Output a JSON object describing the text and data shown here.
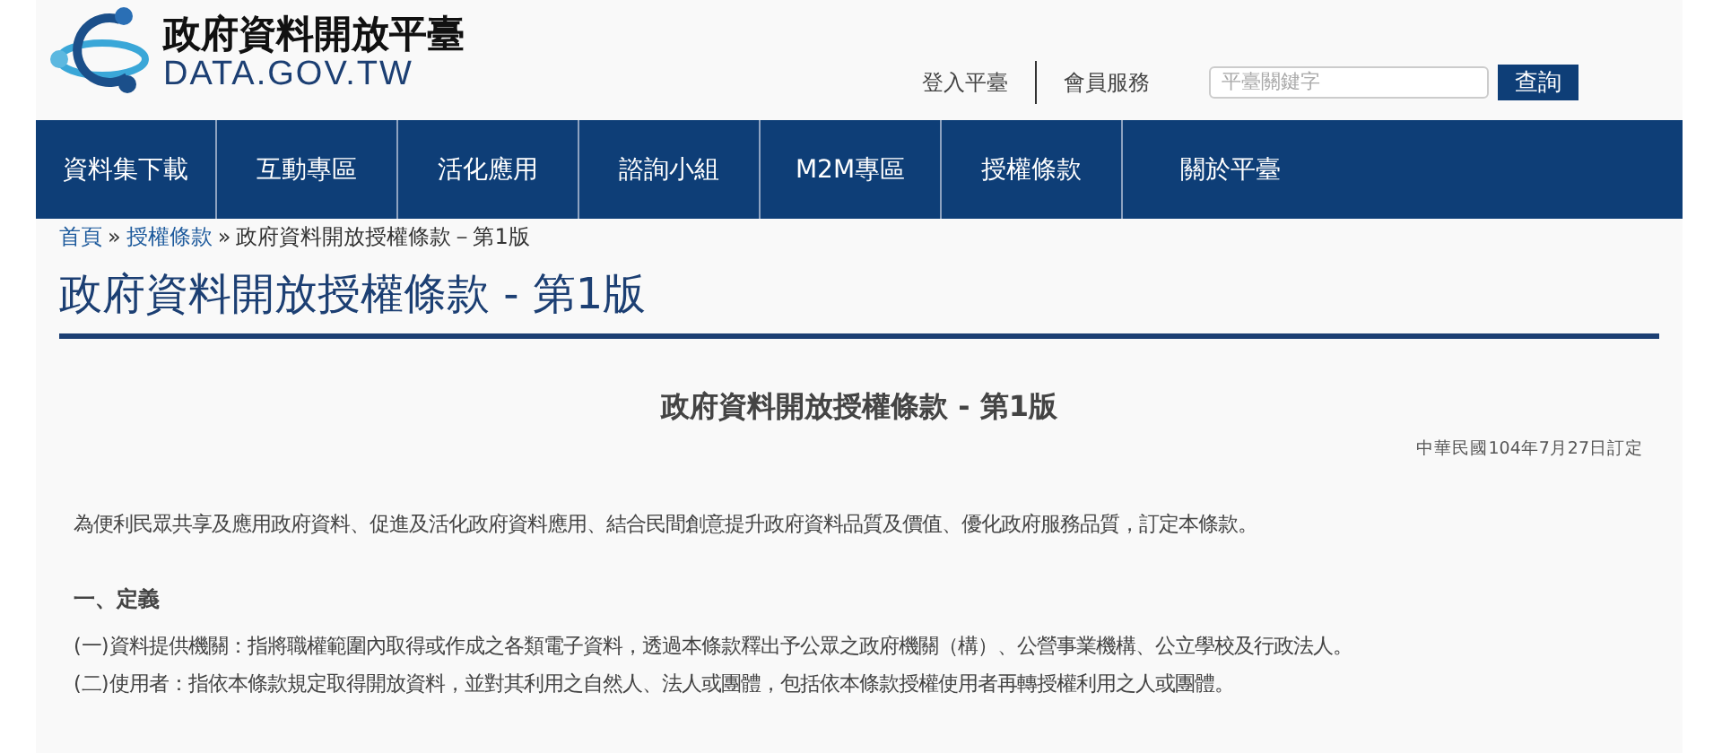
{
  "logo": {
    "title": "政府資料開放平臺",
    "subtitle": "DATA.GOV.TW"
  },
  "top_links": [
    "登入平臺",
    "會員服務"
  ],
  "search": {
    "placeholder": "平臺關鍵字",
    "button": "查詢"
  },
  "nav": [
    "資料集下載",
    "互動專區",
    "活化應用",
    "諮詢小組",
    "M2M專區",
    "授權條款",
    "關於平臺"
  ],
  "breadcrumb": {
    "links": [
      "首頁",
      "授權條款"
    ],
    "separator": "»",
    "current": "政府資料開放授權條款－第1版"
  },
  "page_title": "政府資料開放授權條款 - 第1版",
  "document": {
    "title": "政府資料開放授權條款 - 第1版",
    "date": "中華民國104年7月27日訂定",
    "intro": "為便利民眾共享及應用政府資料、促進及活化政府資料應用、結合民間創意提升政府資料品質及價值、優化政府服務品質，訂定本條款。",
    "section": "一、定義",
    "items": [
      "(一)資料提供機關：指將職權範圍內取得或作成之各類電子資料，透過本條款釋出予公眾之政府機關（構）、公營事業機構、公立學校及行政法人。",
      "(二)使用者：指依本條款規定取得開放資料，並對其利用之自然人、法人或團體，包括依本條款授權使用者再轉授權利用之人或團體。"
    ]
  }
}
